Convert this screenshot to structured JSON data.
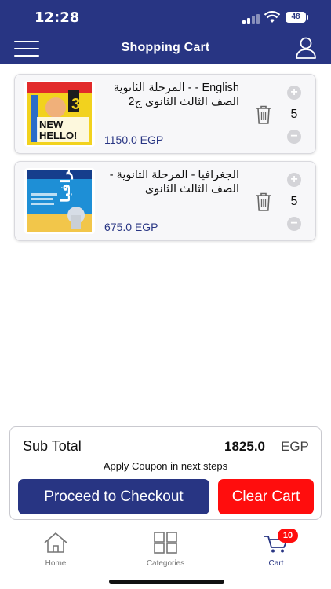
{
  "status_bar": {
    "time": "12:28",
    "battery": "48"
  },
  "nav": {
    "title": "Shopping Cart"
  },
  "cart_items": [
    {
      "title_line1": "English - - المرحلة الثانوية",
      "title_line2": "الصف الثالث الثانوى ج2",
      "price": "1150.0 EGP",
      "quantity": "5",
      "cover_text": "NEW HELLO!"
    },
    {
      "title_line1": "الجغرافيا - المرحلة الثانوية -",
      "title_line2": "الصف الثالث الثانوى",
      "price": "675.0 EGP",
      "quantity": "5",
      "cover_text": "الجغرافيا"
    }
  ],
  "summary": {
    "subtotal_label": "Sub Total",
    "subtotal_amount": "1825.0",
    "currency": "EGP",
    "coupon_note": "Apply Coupon in next steps",
    "checkout_label": "Proceed to Checkout",
    "clear_label": "Clear Cart"
  },
  "tabbar": {
    "home_label": "Home",
    "categories_label": "Categories",
    "cart_label": "Cart",
    "cart_badge": "10"
  },
  "colors": {
    "primary": "#283583",
    "danger": "#ff0d0d"
  },
  "icons": [
    "menu-icon",
    "user-icon",
    "trash-icon",
    "plus-icon",
    "minus-icon",
    "home-icon",
    "grid-icon",
    "cart-icon"
  ]
}
